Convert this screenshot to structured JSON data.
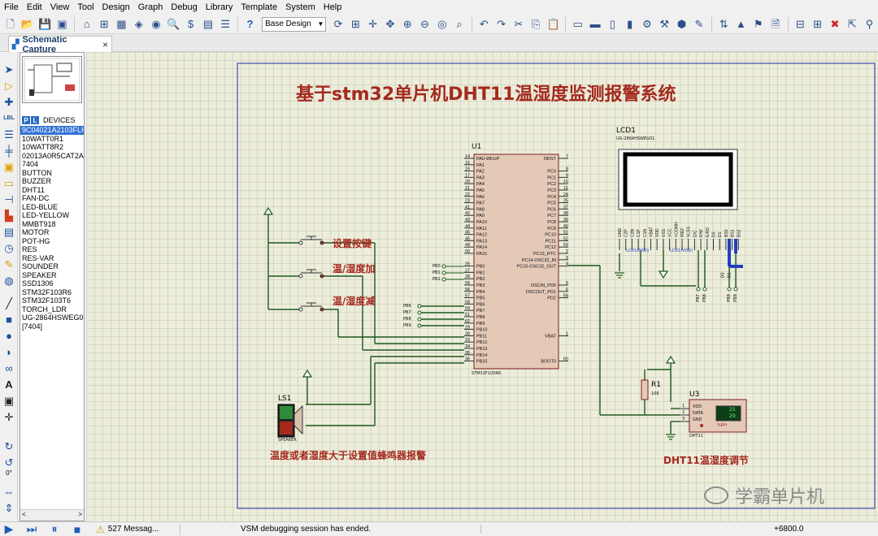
{
  "menu": [
    "File",
    "Edit",
    "View",
    "Tool",
    "Design",
    "Graph",
    "Debug",
    "Library",
    "Template",
    "System",
    "Help"
  ],
  "toolbar": {
    "design_select": "Base Design"
  },
  "tab": {
    "title": "Schematic Capture",
    "close": "×"
  },
  "devices": {
    "p_badge": "P",
    "l_badge": "L",
    "header": "DEVICES",
    "items": [
      "9C04021A2103FLH",
      "10WATT0R1",
      "10WATT8R2",
      "02013A0R5CAT2A",
      "7404",
      "BUTTON",
      "BUZZER",
      "DHT11",
      "FAN-DC",
      "LED-BLUE",
      "LED-YELLOW",
      "MMBT918",
      "MOTOR",
      "POT-HG",
      "RES",
      "RES-VAR",
      "SOUNDER",
      "SPEAKER",
      "SSD1306",
      "STM32F103R6",
      "STM32F103T6",
      "TORCH_LDR",
      "UG-2864HSWEG01",
      "[7404]"
    ],
    "selected_index": 0
  },
  "rotation": "0°",
  "schematic": {
    "title": "基于stm32单片机DHT11温湿度监测报警系统",
    "u1": {
      "ref": "U1",
      "part": "STM32F103R6",
      "left_pins": [
        {
          "num": "14",
          "name": "PA0-WKUP"
        },
        {
          "num": "15",
          "name": "PA1"
        },
        {
          "num": "16",
          "name": "PA2"
        },
        {
          "num": "17",
          "name": "PA3"
        },
        {
          "num": "20",
          "name": "PA4"
        },
        {
          "num": "21",
          "name": "PA5"
        },
        {
          "num": "22",
          "name": "PA6"
        },
        {
          "num": "23",
          "name": "PA7"
        },
        {
          "num": "41",
          "name": "PA8"
        },
        {
          "num": "42",
          "name": "PA9"
        },
        {
          "num": "43",
          "name": "PA10"
        },
        {
          "num": "44",
          "name": "PA11"
        },
        {
          "num": "45",
          "name": "PA12"
        },
        {
          "num": "46",
          "name": "PA13"
        },
        {
          "num": "49",
          "name": "PA14"
        },
        {
          "num": "50",
          "name": "PA15"
        },
        {
          "num": "",
          "name": ""
        },
        {
          "num": "26",
          "name": "PB0"
        },
        {
          "num": "27",
          "name": "PB1"
        },
        {
          "num": "28",
          "name": "PB2"
        },
        {
          "num": "55",
          "name": "PB3"
        },
        {
          "num": "56",
          "name": "PB4"
        },
        {
          "num": "57",
          "name": "PB5"
        },
        {
          "num": "58",
          "name": "PB6"
        },
        {
          "num": "59",
          "name": "PB7"
        },
        {
          "num": "61",
          "name": "PB8"
        },
        {
          "num": "62",
          "name": "PB9"
        },
        {
          "num": "29",
          "name": "PB10"
        },
        {
          "num": "30",
          "name": "PB11"
        },
        {
          "num": "33",
          "name": "PB12"
        },
        {
          "num": "34",
          "name": "PB13"
        },
        {
          "num": "35",
          "name": "PB14"
        },
        {
          "num": "36",
          "name": "PB15"
        }
      ],
      "right_pins": [
        {
          "num": "7",
          "name": "NRST"
        },
        {
          "num": "",
          "name": ""
        },
        {
          "num": "8",
          "name": "PC0"
        },
        {
          "num": "9",
          "name": "PC1"
        },
        {
          "num": "10",
          "name": "PC2"
        },
        {
          "num": "11",
          "name": "PC3"
        },
        {
          "num": "24",
          "name": "PC4"
        },
        {
          "num": "25",
          "name": "PC5"
        },
        {
          "num": "37",
          "name": "PC6"
        },
        {
          "num": "38",
          "name": "PC7"
        },
        {
          "num": "39",
          "name": "PC8"
        },
        {
          "num": "40",
          "name": "PC9"
        },
        {
          "num": "51",
          "name": "PC10"
        },
        {
          "num": "52",
          "name": "PC11"
        },
        {
          "num": "53",
          "name": "PC12"
        },
        {
          "num": "2",
          "name": "PC13_RTC"
        },
        {
          "num": "3",
          "name": "PC14-OSC32_IN"
        },
        {
          "num": "4",
          "name": "PC15-OSC32_OUT"
        },
        {
          "num": "",
          "name": ""
        },
        {
          "num": "",
          "name": ""
        },
        {
          "num": "5",
          "name": "OSCIN_PD0"
        },
        {
          "num": "6",
          "name": "OSCOUT_PD1"
        },
        {
          "num": "54",
          "name": "PD2"
        },
        {
          "num": "",
          "name": ""
        },
        {
          "num": "",
          "name": ""
        },
        {
          "num": "",
          "name": ""
        },
        {
          "num": "",
          "name": ""
        },
        {
          "num": "",
          "name": ""
        },
        {
          "num": "1",
          "name": "VBAT"
        },
        {
          "num": "",
          "name": ""
        },
        {
          "num": "",
          "name": ""
        },
        {
          "num": "",
          "name": ""
        },
        {
          "num": "60",
          "name": "BOOT0"
        }
      ]
    },
    "pb_labels_top": [
      "PB0",
      "PB1",
      "PB2"
    ],
    "pb_labels_mid": [
      "PB6",
      "PB7",
      "PB8",
      "PB9"
    ],
    "buttons": [
      "设置按键",
      "温/湿度加",
      "温/湿度减"
    ],
    "lcd": {
      "ref": "LCD1",
      "part": "UG-2864HSWEG01",
      "pins": [
        "GND",
        "C2P",
        "C2N",
        "C1P",
        "C1N",
        "VBAT",
        "VDD",
        "VSS",
        "VCC",
        "VCOMH",
        "IREF",
        "VLSS",
        "D/C",
        "R/W",
        "E/RD",
        "D0",
        "D1",
        "BS0",
        "BS1",
        "BS2"
      ],
      "net_gnd": "LCD1(GND)",
      "net_vdd": "LCD1(VDD)",
      "bottom_labels": [
        "D0",
        "D1",
        "PB7",
        "PB8",
        "PB9",
        "PB9"
      ]
    },
    "speaker": {
      "ref": "LS1",
      "part": "SPEAKER",
      "caption": "温度或者湿度大于设置值蜂鸣器报警"
    },
    "resistor": {
      "ref": "R1",
      "value": "10K"
    },
    "dht11": {
      "ref": "U3",
      "part": "DHT11",
      "pins": [
        "VDD",
        "DATA",
        "GND"
      ],
      "pin_nums": [
        "1",
        "2",
        "3",
        "4"
      ],
      "temp": "25",
      "hum": "29",
      "unit": "%RH",
      "caption": "DHT11温湿度调节"
    }
  },
  "watermark": "学霸单片机",
  "status": {
    "messages": "527 Messag...",
    "text": "VSM debugging session has ended.",
    "coord": "+6800.0"
  }
}
